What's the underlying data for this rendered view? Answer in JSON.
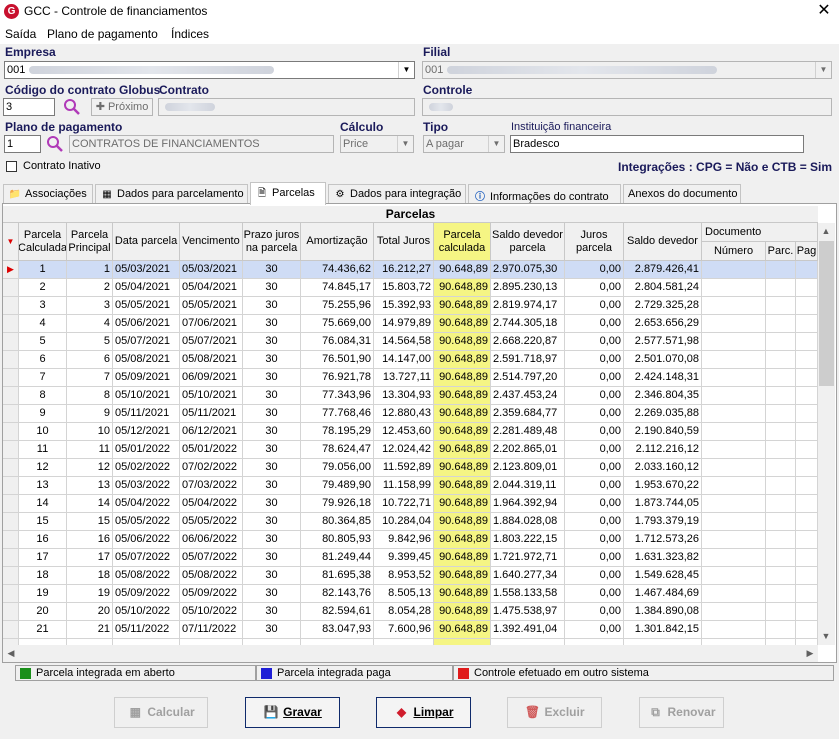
{
  "window": {
    "title": "GCC - Controle de financiamentos",
    "close_glyph": "✕"
  },
  "menu": {
    "items": [
      "Saída",
      "Plano de pagamento",
      "Índices"
    ]
  },
  "form": {
    "empresa_label": "Empresa",
    "empresa_value": "001",
    "filial_label": "Filial",
    "filial_value": "001",
    "codigo_label": "Código do contrato Globus",
    "contrato_label": "Contrato",
    "controle_label": "Controle",
    "codigo_value": "3",
    "proximo_label": "Próximo",
    "plano_label": "Plano de pagamento",
    "plano_code": "1",
    "plano_desc": "CONTRATOS DE FINANCIAMENTOS",
    "calculo_label": "Cálculo",
    "calculo_value": "Price",
    "tipo_label": "Tipo",
    "tipo_value": "A pagar",
    "instituicao_label": "Instituição financeira",
    "instituicao_value": "Bradesco",
    "contrato_inativo_label": "Contrato Inativo",
    "integracoes_text": "Integrações : CPG = Não e CTB = Sim"
  },
  "tabs": [
    {
      "label": "Associações",
      "icon": "folder-icon"
    },
    {
      "label": "Dados para parcelamento",
      "icon": "table-icon"
    },
    {
      "label": "Parcelas",
      "icon": "document-icon"
    },
    {
      "label": "Dados para integração",
      "icon": "gear-icon"
    },
    {
      "label": "Informações do contrato",
      "icon": "info-icon"
    },
    {
      "label": "Anexos do documento",
      "icon": ""
    }
  ],
  "grid": {
    "title": "Parcelas",
    "columns": [
      "Parcela Calculada",
      "Parcela Principal",
      "Data parcela",
      "Vencimento",
      "Prazo juros na parcela",
      "Amortização",
      "Total Juros",
      "Parcela calculada",
      "Saldo devedor parcela",
      "Juros parcela",
      "Saldo devedor"
    ],
    "documento_header": "Documento",
    "documento_sub": [
      "Número",
      "Parc.",
      "Pag"
    ],
    "rows": [
      [
        "1",
        "1",
        "05/03/2021",
        "05/03/2021",
        "30",
        "74.436,62",
        "16.212,27",
        "90.648,89",
        "2.970.075,30",
        "0,00",
        "2.879.426,41"
      ],
      [
        "2",
        "2",
        "05/04/2021",
        "05/04/2021",
        "30",
        "74.845,17",
        "15.803,72",
        "90.648,89",
        "2.895.230,13",
        "0,00",
        "2.804.581,24"
      ],
      [
        "3",
        "3",
        "05/05/2021",
        "05/05/2021",
        "30",
        "75.255,96",
        "15.392,93",
        "90.648,89",
        "2.819.974,17",
        "0,00",
        "2.729.325,28"
      ],
      [
        "4",
        "4",
        "05/06/2021",
        "07/06/2021",
        "30",
        "75.669,00",
        "14.979,89",
        "90.648,89",
        "2.744.305,18",
        "0,00",
        "2.653.656,29"
      ],
      [
        "5",
        "5",
        "05/07/2021",
        "05/07/2021",
        "30",
        "76.084,31",
        "14.564,58",
        "90.648,89",
        "2.668.220,87",
        "0,00",
        "2.577.571,98"
      ],
      [
        "6",
        "6",
        "05/08/2021",
        "05/08/2021",
        "30",
        "76.501,90",
        "14.147,00",
        "90.648,89",
        "2.591.718,97",
        "0,00",
        "2.501.070,08"
      ],
      [
        "7",
        "7",
        "05/09/2021",
        "06/09/2021",
        "30",
        "76.921,78",
        "13.727,11",
        "90.648,89",
        "2.514.797,20",
        "0,00",
        "2.424.148,31"
      ],
      [
        "8",
        "8",
        "05/10/2021",
        "05/10/2021",
        "30",
        "77.343,96",
        "13.304,93",
        "90.648,89",
        "2.437.453,24",
        "0,00",
        "2.346.804,35"
      ],
      [
        "9",
        "9",
        "05/11/2021",
        "05/11/2021",
        "30",
        "77.768,46",
        "12.880,43",
        "90.648,89",
        "2.359.684,77",
        "0,00",
        "2.269.035,88"
      ],
      [
        "10",
        "10",
        "05/12/2021",
        "06/12/2021",
        "30",
        "78.195,29",
        "12.453,60",
        "90.648,89",
        "2.281.489,48",
        "0,00",
        "2.190.840,59"
      ],
      [
        "11",
        "11",
        "05/01/2022",
        "05/01/2022",
        "30",
        "78.624,47",
        "12.024,42",
        "90.648,89",
        "2.202.865,01",
        "0,00",
        "2.112.216,12"
      ],
      [
        "12",
        "12",
        "05/02/2022",
        "07/02/2022",
        "30",
        "79.056,00",
        "11.592,89",
        "90.648,89",
        "2.123.809,01",
        "0,00",
        "2.033.160,12"
      ],
      [
        "13",
        "13",
        "05/03/2022",
        "07/03/2022",
        "30",
        "79.489,90",
        "11.158,99",
        "90.648,89",
        "2.044.319,11",
        "0,00",
        "1.953.670,22"
      ],
      [
        "14",
        "14",
        "05/04/2022",
        "05/04/2022",
        "30",
        "79.926,18",
        "10.722,71",
        "90.648,89",
        "1.964.392,94",
        "0,00",
        "1.873.744,05"
      ],
      [
        "15",
        "15",
        "05/05/2022",
        "05/05/2022",
        "30",
        "80.364,85",
        "10.284,04",
        "90.648,89",
        "1.884.028,08",
        "0,00",
        "1.793.379,19"
      ],
      [
        "16",
        "16",
        "05/06/2022",
        "06/06/2022",
        "30",
        "80.805,93",
        "9.842,96",
        "90.648,89",
        "1.803.222,15",
        "0,00",
        "1.712.573,26"
      ],
      [
        "17",
        "17",
        "05/07/2022",
        "05/07/2022",
        "30",
        "81.249,44",
        "9.399,45",
        "90.648,89",
        "1.721.972,71",
        "0,00",
        "1.631.323,82"
      ],
      [
        "18",
        "18",
        "05/08/2022",
        "05/08/2022",
        "30",
        "81.695,38",
        "8.953,52",
        "90.648,89",
        "1.640.277,34",
        "0,00",
        "1.549.628,45"
      ],
      [
        "19",
        "19",
        "05/09/2022",
        "05/09/2022",
        "30",
        "82.143,76",
        "8.505,13",
        "90.648,89",
        "1.558.133,58",
        "0,00",
        "1.467.484,69"
      ],
      [
        "20",
        "20",
        "05/10/2022",
        "05/10/2022",
        "30",
        "82.594,61",
        "8.054,28",
        "90.648,89",
        "1.475.538,97",
        "0,00",
        "1.384.890,08"
      ],
      [
        "21",
        "21",
        "05/11/2022",
        "07/11/2022",
        "30",
        "83.047,93",
        "7.600,96",
        "90.648,89",
        "1.392.491,04",
        "0,00",
        "1.301.842,15"
      ]
    ]
  },
  "legend": [
    {
      "label": "Parcela integrada em aberto",
      "color": "#1a8f1a"
    },
    {
      "label": "Parcela integrada paga",
      "color": "#1f1fd6"
    },
    {
      "label": "Controle efetuado em outro sistema",
      "color": "#e01b1b"
    }
  ],
  "buttons": {
    "calcular": "Calcular",
    "gravar": "Gravar",
    "limpar": "Limpar",
    "excluir": "Excluir",
    "renovar": "Renovar"
  }
}
